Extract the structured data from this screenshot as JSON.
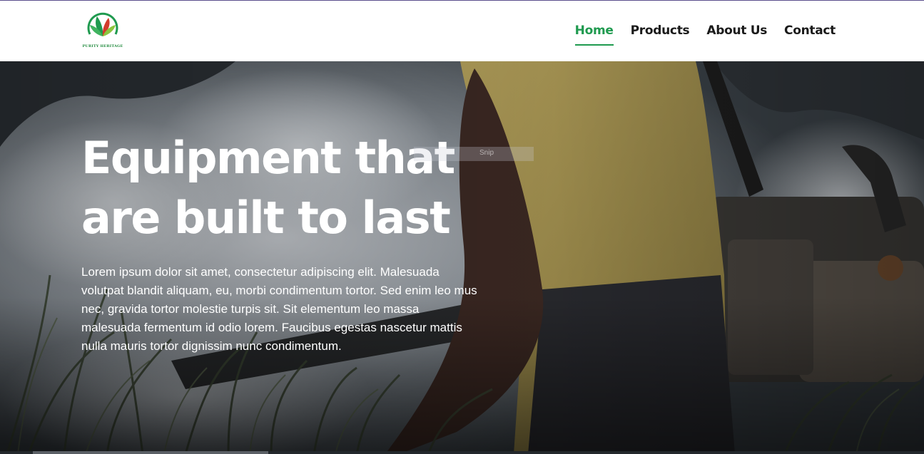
{
  "brand": {
    "logo_text": "PURITY HERITAGE",
    "icon": "leaf-logo-icon",
    "colors": {
      "green": "#1f9a4f",
      "red": "#d23c2c"
    }
  },
  "nav": {
    "items": [
      {
        "label": "Home",
        "active": true
      },
      {
        "label": "Products",
        "active": false
      },
      {
        "label": "About Us",
        "active": false
      },
      {
        "label": "Contact",
        "active": false
      }
    ]
  },
  "hero": {
    "title": "Equipment that are built to last",
    "body": "Lorem ipsum dolor sit amet, consectetur adipiscing elit. Malesuada volutpat blandit aliquam, eu, morbi condimentum tortor. Sed enim leo mus nec, gravida tortor molestie turpis sit. Sit elementum leo massa malesuada fermentum id odio lorem. Faucibus egestas nascetur mattis nulla mauris tortor dignissim nunc condimentum.",
    "overlay_chip_text": "Snip",
    "image_description_icon": "fogging-worker-photo"
  }
}
